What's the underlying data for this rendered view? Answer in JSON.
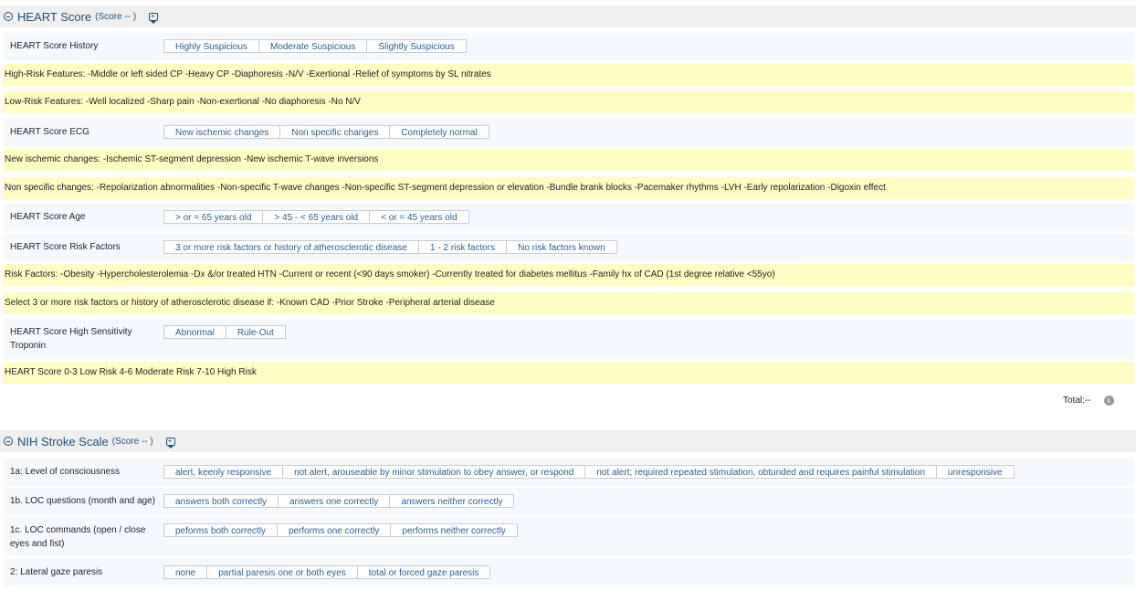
{
  "heart": {
    "title": "HEART Score",
    "score": "(Score -- )",
    "history": {
      "label": "HEART Score History",
      "options": [
        "Highly Suspicious",
        "Moderate Suspicious",
        "Slightly Suspicious"
      ]
    },
    "high_risk_note": "High-Risk Features: -Middle or left sided CP -Heavy CP -Diaphoresis -N/V -Exertional -Relief of symptoms by SL nitrates",
    "low_risk_note": "Low-Risk Features: -Well localized -Sharp pain -Non-exertional -No diaphoresis -No N/V",
    "ecg": {
      "label": "HEART Score ECG",
      "options": [
        "New ischemic changes",
        "Non specific changes",
        "Completely normal"
      ]
    },
    "ischemic_note": "New ischemic changes: -Ischemic ST-segment depression -New ischemic T-wave inversions",
    "nonspecific_note": "Non specific changes: -Repolarization abnormalities -Non-specific T-wave changes -Non-specific ST-segment depression or elevation -Bundle brank blocks -Pacemaker rhythms -LVH -Early repolarization -Digoxin effect",
    "age": {
      "label": "HEART Score Age",
      "options": [
        "> or = 65 years old",
        "> 45 - < 65 years old",
        "< or = 45 years old"
      ]
    },
    "risk_factors": {
      "label": "HEART Score Risk Factors",
      "options": [
        "3 or more risk factors or history of atherosclerotic disease",
        "1 - 2 risk factors",
        "No risk factors known"
      ]
    },
    "risk_factors_note": "Risk Factors: -Obesity -Hypercholesterolemia -Dx &/or treated HTN -Current or recent (<90 days smoker) -Currently treated for diabetes mellitus -Family hx of CAD (1st degree relative <55yo)",
    "select_note": "Select 3 or more risk factors or history of atherosclerotic disease if: -Known CAD -Prior Stroke -Peripheral arterial disease",
    "troponin": {
      "label": "HEART Score High Sensitivity Troponin",
      "options": [
        "Abnormal",
        "Rule-Out"
      ]
    },
    "score_note": "HEART Score 0-3 Low Risk 4-6 Moderate Risk 7-10 High Risk",
    "total_label": "Total:--"
  },
  "nih": {
    "title": "NIH Stroke Scale",
    "score": "(Score -- )",
    "consciousness": {
      "label": "1a: Level of consciousness",
      "options": [
        "alert, keenly responsive",
        "not alert, arouseable by minor stimulation to obey answer, or respond",
        "not alert; required repeated stimulation, obtunded and requires painful stimulation",
        "unresponsive"
      ]
    },
    "loc_questions": {
      "label": "1b. LOC questions (month and age)",
      "options": [
        "answers both correctly",
        "answers one correctly",
        "answers neither correctly"
      ]
    },
    "loc_commands": {
      "label": "1c. LOC commands (open / close eyes and fist)",
      "options": [
        "peforms both correctly",
        "performs one correctly",
        "performs neither correctly"
      ]
    },
    "gaze": {
      "label": "2: Lateral gaze paresis",
      "options": [
        "none",
        "partial paresis one or both eyes",
        "total or forced gaze paresis"
      ]
    }
  },
  "colors": {
    "accent": "#1f4f7a",
    "option_text": "#2a5f8f",
    "note_bg": "#fefdc4",
    "row_bg": "#f6f9fc",
    "header_bg": "#efefef"
  }
}
